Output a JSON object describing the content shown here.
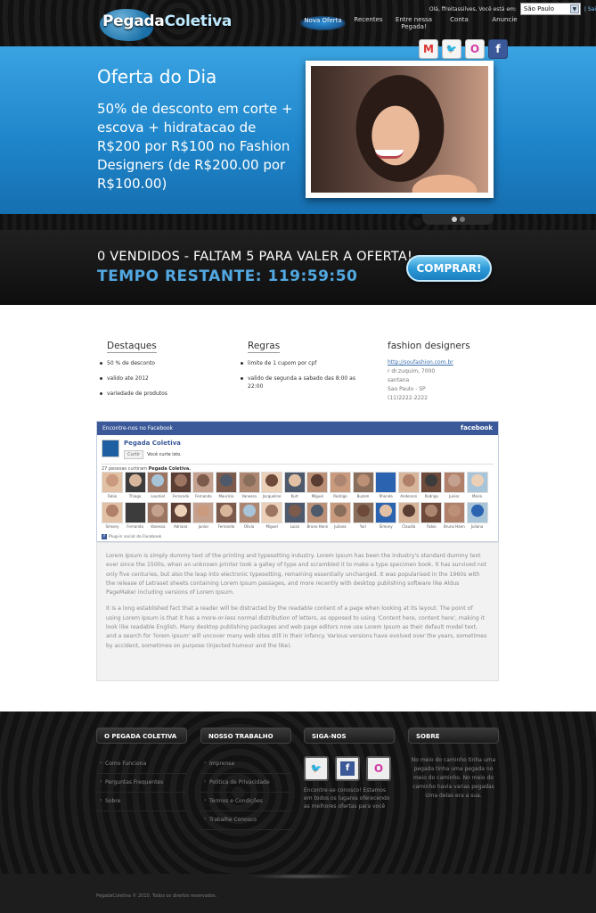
{
  "brand": {
    "logo_part1": "Pegada",
    "logo_part2": "Coletiva"
  },
  "topbar": {
    "greeting": "Olá, ffreitassilves, Você está em:",
    "city": "São Paulo",
    "login_link": "| Sai"
  },
  "nav": [
    {
      "label": "Nova Oferta"
    },
    {
      "label": "Recentes"
    },
    {
      "label": "Entre nessa Pegada!"
    },
    {
      "label": "Conta"
    },
    {
      "label": "Anuncie"
    }
  ],
  "social_icons": [
    "gmail-icon",
    "twitter-icon",
    "orkut-icon",
    "facebook-icon"
  ],
  "hero": {
    "title": "Oferta do Dia",
    "description": "50% de desconto em corte + escova + hidratacao de R$200 por R$100 no Fashion Designers (de R$200.00 por R$100.00)"
  },
  "countdown": {
    "status": "0 VENDIDOS - FALTAM 5 PARA VALER A OFERTA!",
    "time": "TEMPO RESTANTE: 119:59:50",
    "buy_label": "COMPRAR!"
  },
  "columns": {
    "destaques": {
      "title": "Destaques",
      "items": [
        "50 % de desconto",
        "valido ate 2012",
        "variedade de produtos"
      ]
    },
    "regras": {
      "title": "Regras",
      "items": [
        "limite de 1 cupom por cpf",
        "valido de segunda a sabado das 8:00 as 22:00"
      ]
    },
    "company": {
      "title": "fashion designers",
      "link": "http://soufashion.com.br",
      "street": "r dr.zuquim, 7000",
      "district": "santana",
      "city": "Sao Paulo - SP",
      "phone": "(11)2222-2222"
    }
  },
  "facebook": {
    "header": "Encontre-nos no Facebook",
    "brand": "facebook",
    "page_name": "Pegada Coletiva",
    "like_label": "Curtir",
    "like_text": "Você curte isto.",
    "count_text": "27 pessoas curtiram",
    "count_page": "Pegada Coletiva.",
    "fans_row1": [
      "Fabio",
      "Thiago",
      "Loumiel",
      "Fernando",
      "Fernando",
      "Maurício",
      "Vanessa",
      "Jacqueline",
      "Kurt",
      "Miguel",
      "Rodrigo",
      "Buzem",
      "Rhonda",
      "Anderson",
      "Rodrigo",
      "Junior",
      "Mario"
    ],
    "fans_row2": [
      "Simony",
      "Fernanda",
      "Vanessa",
      "Adriana",
      "Junior",
      "Fernando",
      "Olivia",
      "Miguel",
      "Luiza",
      "Bruno Hann",
      "Juliana",
      "Yuri",
      "Simony",
      "Claudia",
      "Fabio",
      "Bruno Hann",
      "Juliana"
    ],
    "footer": "Plug-in social do Facebook"
  },
  "lorem": {
    "p1": "Lorem Ipsum is simply dummy text of the printing and typesetting industry. Lorem Ipsum has been the industry's standard dummy text ever since the 1500s, when an unknown printer took a galley of type and scrambled it to make a type specimen book. It has survived not only five centuries, but also the leap into electronic typesetting, remaining essentially unchanged. It was popularised in the 1960s with the release of Letraset sheets containing Lorem Ipsum passages, and more recently with desktop publishing software like Aldus PageMaker including versions of Lorem Ipsum.",
    "p2": "It is a long established fact that a reader will be distracted by the readable content of a page when looking at its layout. The point of using Lorem Ipsum is that it has a more-or-less normal distribution of letters, as opposed to using 'Content here, content here', making it look like readable English. Many desktop publishing packages and web page editors now use Lorem Ipsum as their default model text, and a search for 'lorem ipsum' will uncover many web sites still in their infancy. Various versions have evolved over the years, sometimes by accident, sometimes on purpose (injected humour and the like)."
  },
  "footer": {
    "col1": {
      "title": "O PEGADA COLETIVA",
      "links": [
        "Como Funciona",
        "Perguntas Frequentes",
        "Sobre"
      ]
    },
    "col2": {
      "title": "NOSSO TRABALHO",
      "links": [
        "Imprensa",
        "Politica de Privacidade",
        "Termos e Condições",
        "Trabalhe Conosco"
      ]
    },
    "col3": {
      "title": "SIGA-NOS",
      "text": "Encontre-se conosco! Estamos em todos os lugares oferecendo as melhores ofertas para você"
    },
    "col4": {
      "title": "SOBRE",
      "poem": "No meio do caminho tinha uma pegada tinha uma pegada no meio do caminho. No meio do caminho havia varias pegadas Uma delas era a sua."
    },
    "copyright": "PegadaColetiva © 2010. Todos os direitos reservados."
  },
  "colors": {
    "accent_blue": "#1f86cb",
    "time_blue": "#52a8e0",
    "facebook": "#3b5998"
  }
}
